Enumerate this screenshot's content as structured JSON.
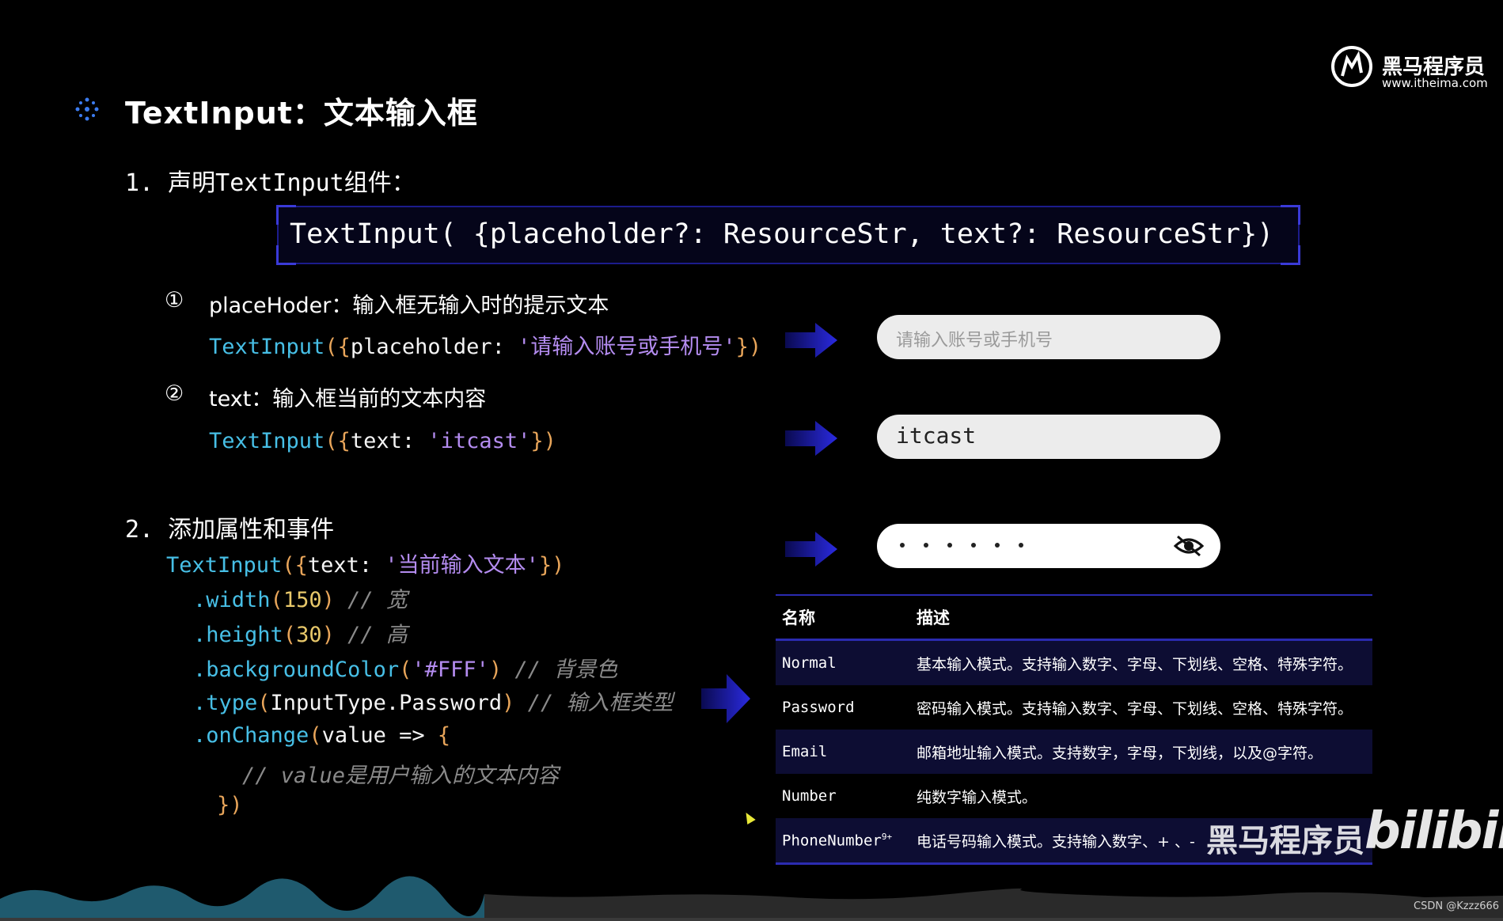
{
  "logo": {
    "name": "黑马程序员",
    "url": "www.itheima.com"
  },
  "title": "TextInput：文本输入框",
  "section1": {
    "heading": "1. 声明TextInput组件：",
    "signature": "TextInput( {placeholder?: ResourceStr, text?: ResourceStr})"
  },
  "item1": {
    "marker": "①",
    "label": "placeHoder：输入框无输入时的提示文本",
    "code_fn": "TextInput",
    "code_open": "({",
    "code_key": "placeholder: ",
    "code_str": "'请输入账号或手机号'",
    "code_close": "})"
  },
  "item2": {
    "marker": "②",
    "label": "text：输入框当前的文本内容",
    "code_fn": "TextInput",
    "code_open": "({",
    "code_key": "text: ",
    "code_str": "'itcast'",
    "code_close": "})"
  },
  "demo": {
    "placeholder_input": "请输入账号或手机号",
    "text_input": "itcast",
    "password_icon": "eye-slash-icon"
  },
  "section2": {
    "heading": "2. 添加属性和事件",
    "line1": {
      "fn": "TextInput",
      "open": "({",
      "key": "text: ",
      "str": "'当前输入文本'",
      "close": "})"
    },
    "line2": {
      "method": ".width",
      "open": "(",
      "arg": "150",
      "close": ")",
      "comment": "// 宽"
    },
    "line3": {
      "method": ".height",
      "open": "(",
      "arg": "30",
      "close": ")",
      "comment": "// 高"
    },
    "line4": {
      "method": ".backgroundColor",
      "open": "(",
      "arg": "'#FFF'",
      "close": ")",
      "comment": "// 背景色"
    },
    "line5": {
      "method": ".type",
      "open": "(",
      "arg": "InputType.Password",
      "close": ")",
      "comment": "// 输入框类型"
    },
    "line6": {
      "method": ".onChange",
      "open": "(",
      "arg": "value => ",
      "brace": "{"
    },
    "line7": {
      "comment": "// value是用户输入的文本内容"
    },
    "line8": {
      "close": "})"
    }
  },
  "table": {
    "headers": [
      "名称",
      "描述"
    ],
    "rows": [
      {
        "name": "Normal",
        "sup": "",
        "desc": "基本输入模式。支持输入数字、字母、下划线、空格、特殊字符。"
      },
      {
        "name": "Password",
        "sup": "",
        "desc": "密码输入模式。支持输入数字、字母、下划线、空格、特殊字符。"
      },
      {
        "name": "Email",
        "sup": "",
        "desc": "邮箱地址输入模式。支持数字，字母，下划线，以及@字符。"
      },
      {
        "name": "Number",
        "sup": "",
        "desc": "纯数字输入模式。"
      },
      {
        "name": "PhoneNumber",
        "sup": "9+",
        "desc": "电话号码输入模式。支持输入数字、+ 、-"
      }
    ]
  },
  "watermark": {
    "text": "黑马程序员",
    "bilibili": "bilibili"
  },
  "credit": "CSDN @Kzzz666",
  "colors": {
    "keyword": "#47bfe6",
    "string": "#b48cf0",
    "number": "#e8c86a",
    "comment": "#8a8a8a",
    "accent": "#2b2bb0",
    "arrow": "#2a2ae0"
  }
}
